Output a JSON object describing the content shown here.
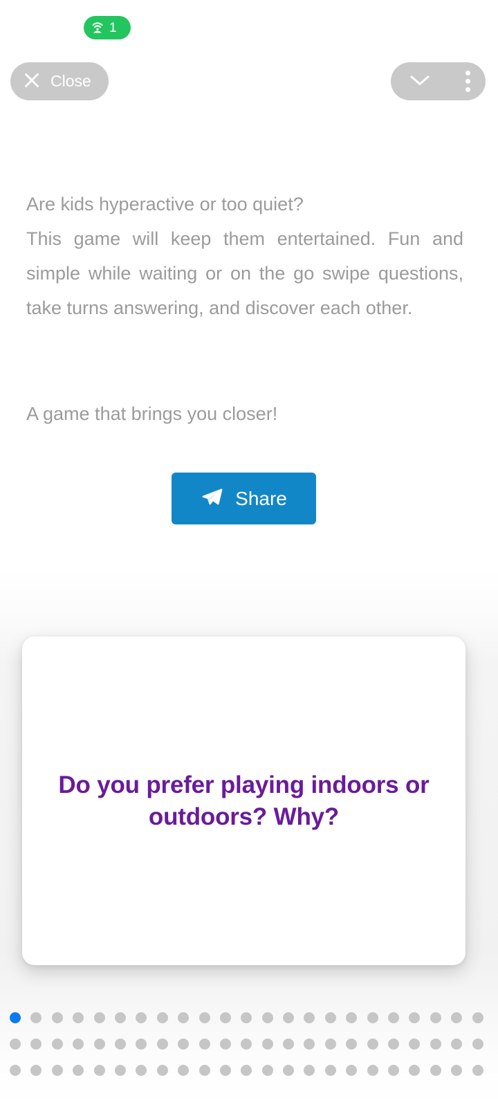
{
  "status": {
    "cast_badge": {
      "icon": "cast-hotspot-icon",
      "count": "1",
      "color": "#22c55e"
    }
  },
  "topbar": {
    "close_button": {
      "label": "Close",
      "icon": "close-x-icon"
    },
    "collapse_button": {
      "icon": "chevron-down-icon"
    },
    "more_button": {
      "icon": "more-vertical-icon"
    },
    "pill_color": "#c9c9c9"
  },
  "content": {
    "description_lead": "Are kids hyperactive or too quiet?",
    "description_body": "This game will keep them entertained. Fun and simple while waiting or on the go swipe questions, take turns answering, and discover each other.",
    "tagline": "A game that brings you closer!",
    "text_color": "#9b9b9b"
  },
  "share": {
    "label": "Share",
    "icon": "send-paper-plane-icon",
    "color": "#1287c8"
  },
  "card": {
    "question": "Do you prefer playing indoors or outdoors? Why?",
    "text_color": "#6a1b9a"
  },
  "pagination": {
    "total": 69,
    "active_index": 0,
    "active_color": "#0b7bf0",
    "inactive_color": "#c6c6c6"
  }
}
